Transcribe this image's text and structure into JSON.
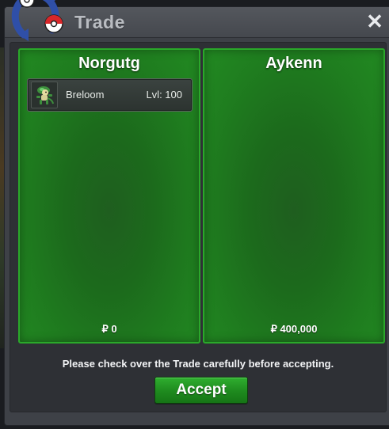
{
  "window": {
    "title": "Trade",
    "close_label": "✕"
  },
  "left_panel": {
    "name": "Norgutg",
    "money": "₽ 0",
    "items": [
      {
        "name": "Breloom",
        "level": "Lvl: 100",
        "icon": "breloom-sprite"
      }
    ]
  },
  "right_panel": {
    "name": "Aykenn",
    "money": "₽ 400,000",
    "items": []
  },
  "footer": {
    "notice": "Please check over the Trade carefully before accepting.",
    "accept_label": "Accept"
  },
  "colors": {
    "panel_green": "#1f7d1f",
    "panel_border": "#2aa82a",
    "accept_green": "#1e8a1e",
    "window_gray": "#3e4147"
  }
}
